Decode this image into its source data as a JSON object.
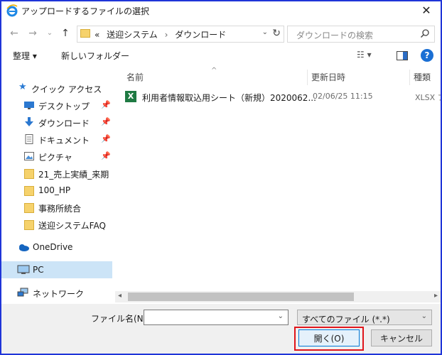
{
  "window": {
    "title": "アップロードするファイルの選択"
  },
  "address": {
    "breadcrumb_prefix": "«",
    "crumbs": [
      "送迎システム",
      "ダウンロード"
    ],
    "separator": "›"
  },
  "search": {
    "placeholder": "ダウンロードの検索"
  },
  "toolbar": {
    "organize": "整理 ▾",
    "new_folder": "新しいフォルダー"
  },
  "sidebar": {
    "quick_access": "クイック アクセス",
    "items": [
      {
        "label": "デスクトップ",
        "icon": "desktop-icon"
      },
      {
        "label": "ダウンロード",
        "icon": "download-icon"
      },
      {
        "label": "ドキュメント",
        "icon": "document-icon"
      },
      {
        "label": "ピクチャ",
        "icon": "picture-icon"
      },
      {
        "label": "21_売上実績_来期",
        "icon": "folder-icon"
      },
      {
        "label": "100_HP",
        "icon": "folder-icon"
      },
      {
        "label": "事務所統合",
        "icon": "folder-icon"
      },
      {
        "label": "送迎システムFAQ",
        "icon": "folder-icon"
      }
    ],
    "onedrive": "OneDrive",
    "pc": "PC",
    "network": "ネットワーク"
  },
  "columns": {
    "name": "名前",
    "modified": "更新日時",
    "type": "種類"
  },
  "files": [
    {
      "name": "利用者情報取込用シート（新規）2020062...",
      "modified": "02/06/25 11:15",
      "type": "XLSX フ"
    }
  ],
  "footer": {
    "filename_label": "ファイル名(N):",
    "filename_value": "",
    "filetype": "すべてのファイル (*.*)",
    "open_button": "開く(O)",
    "cancel_button": "キャンセル"
  },
  "colors": {
    "frame": "#1f35d8",
    "highlight": "#e0151b",
    "selection": "#cce4f7"
  }
}
